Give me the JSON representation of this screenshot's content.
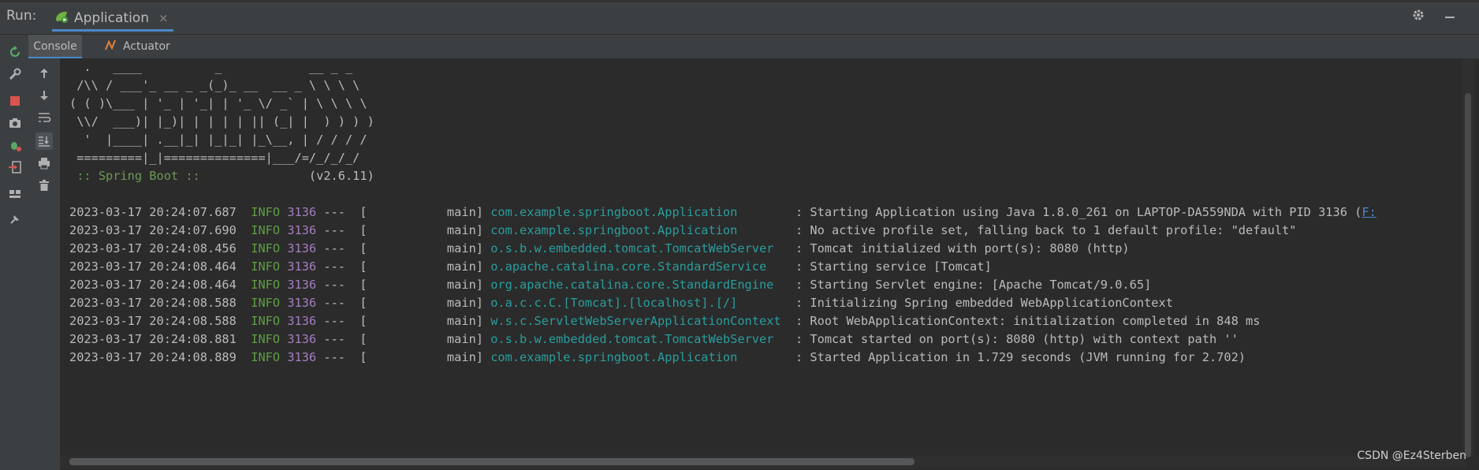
{
  "topbar": {
    "run_label": "Run:",
    "tab_title": "Application",
    "close_glyph": "×"
  },
  "subtabs": {
    "console": "Console",
    "actuator": "Actuator"
  },
  "banner": [
    "  .   ____          _            __ _ _",
    " /\\\\ / ___'_ __ _ _(_)_ __  __ _ \\ \\ \\ \\",
    "( ( )\\___ | '_ | '_| | '_ \\/ _` | \\ \\ \\ \\",
    " \\\\/  ___)| |_)| | | | | || (_| |  ) ) ) )",
    "  '  |____| .__|_| |_|_| |_\\__, | / / / /",
    " =========|_|==============|___/=/_/_/_/"
  ],
  "spring_boot": {
    "label": " :: Spring Boot ::",
    "version": "               (v2.6.11)"
  },
  "logs": [
    {
      "ts": "2023-03-17 20:24:07.687",
      "level": "INFO",
      "pid": "3136",
      "thread": "---  [           main] ",
      "logger": "com.example.springboot.Application       ",
      "msg": ": Starting Application using Java 1.8.0_261 on LAPTOP-DA559NDA with PID 3136 (",
      "link": "F:"
    },
    {
      "ts": "2023-03-17 20:24:07.690",
      "level": "INFO",
      "pid": "3136",
      "thread": "---  [           main] ",
      "logger": "com.example.springboot.Application       ",
      "msg": ": No active profile set, falling back to 1 default profile: \"default\"",
      "link": ""
    },
    {
      "ts": "2023-03-17 20:24:08.456",
      "level": "INFO",
      "pid": "3136",
      "thread": "---  [           main] ",
      "logger": "o.s.b.w.embedded.tomcat.TomcatWebServer  ",
      "msg": ": Tomcat initialized with port(s): 8080 (http)",
      "link": ""
    },
    {
      "ts": "2023-03-17 20:24:08.464",
      "level": "INFO",
      "pid": "3136",
      "thread": "---  [           main] ",
      "logger": "o.apache.catalina.core.StandardService   ",
      "msg": ": Starting service [Tomcat]",
      "link": ""
    },
    {
      "ts": "2023-03-17 20:24:08.464",
      "level": "INFO",
      "pid": "3136",
      "thread": "---  [           main] ",
      "logger": "org.apache.catalina.core.StandardEngine  ",
      "msg": ": Starting Servlet engine: [Apache Tomcat/9.0.65]",
      "link": ""
    },
    {
      "ts": "2023-03-17 20:24:08.588",
      "level": "INFO",
      "pid": "3136",
      "thread": "---  [           main] ",
      "logger": "o.a.c.c.C.[Tomcat].[localhost].[/]       ",
      "msg": ": Initializing Spring embedded WebApplicationContext",
      "link": ""
    },
    {
      "ts": "2023-03-17 20:24:08.588",
      "level": "INFO",
      "pid": "3136",
      "thread": "---  [           main] ",
      "logger": "w.s.c.ServletWebServerApplicationContext ",
      "msg": ": Root WebApplicationContext: initialization completed in 848 ms",
      "link": ""
    },
    {
      "ts": "2023-03-17 20:24:08.881",
      "level": "INFO",
      "pid": "3136",
      "thread": "---  [           main] ",
      "logger": "o.s.b.w.embedded.tomcat.TomcatWebServer  ",
      "msg": ": Tomcat started on port(s): 8080 (http) with context path ''",
      "link": ""
    },
    {
      "ts": "2023-03-17 20:24:08.889",
      "level": "INFO",
      "pid": "3136",
      "thread": "---  [           main] ",
      "logger": "com.example.springboot.Application       ",
      "msg": ": Started Application in 1.729 seconds (JVM running for 2.702)",
      "link": ""
    }
  ],
  "watermark": "CSDN @Ez4Sterben",
  "icons": {
    "run_tab": "spring-run-icon",
    "settings": "gear-icon",
    "minimize": "minimize-icon",
    "rerun": "rerun-icon",
    "wrench": "wrench-icon",
    "stop": "stop-icon",
    "camera": "camera-icon",
    "debug": "debug-icon",
    "login": "exit-icon",
    "layout": "layout-icon",
    "pin": "pin-icon",
    "up": "arrow-up-icon",
    "down": "arrow-down-icon",
    "wrap": "soft-wrap-icon",
    "scroll_end": "scroll-to-end-icon",
    "print": "print-icon",
    "trash": "trash-icon",
    "actuator": "actuator-icon"
  },
  "colors": {
    "info": "#5f9e43",
    "pid": "#a57ec0",
    "logger": "#2a9d9d",
    "link": "#4a88c7",
    "accent": "#4a88c7"
  }
}
